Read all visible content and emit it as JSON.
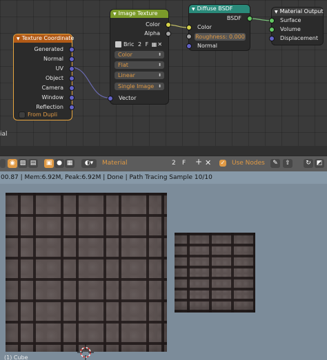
{
  "node_editor": {
    "nodes": {
      "texture_coordinate": {
        "title": "Texture Coordinate",
        "outputs": [
          "Generated",
          "Normal",
          "UV",
          "Object",
          "Camera",
          "Window",
          "Reflection"
        ],
        "from_dupli": "From Dupli"
      },
      "image_texture": {
        "title": "Image Texture",
        "outputs": [
          "Color",
          "Alpha"
        ],
        "image_name": "Bric",
        "users": "2",
        "fake_user": "F",
        "color_space": "Color",
        "projection": "Flat",
        "interpolation": "Linear",
        "extension": "Single Image",
        "input_vector": "Vector"
      },
      "diffuse_bsdf": {
        "title": "Diffuse BSDF",
        "output": "BSDF",
        "input_color": "Color",
        "roughness": "Roughness: 0.000",
        "input_normal": "Normal"
      },
      "material_output": {
        "title": "Material Output",
        "inputs": [
          "Surface",
          "Volume",
          "Displacement"
        ]
      }
    },
    "side_label": "ial",
    "colors": {
      "image_header": "#7b9a2a",
      "tex_coord_header": "#b25a16",
      "shader_header": "#2a8a7a",
      "output_header": "#3c3c3c"
    }
  },
  "header": {
    "shader_type": "Material",
    "users": "2",
    "fake_user": "F",
    "use_nodes": "Use Nodes"
  },
  "status_bar": {
    "text": "00.87 | Mem:6.92M, Peak:6.92M | Done | Path Tracing Sample 10/10"
  },
  "viewport": {
    "object_label": "(1) Cube"
  }
}
